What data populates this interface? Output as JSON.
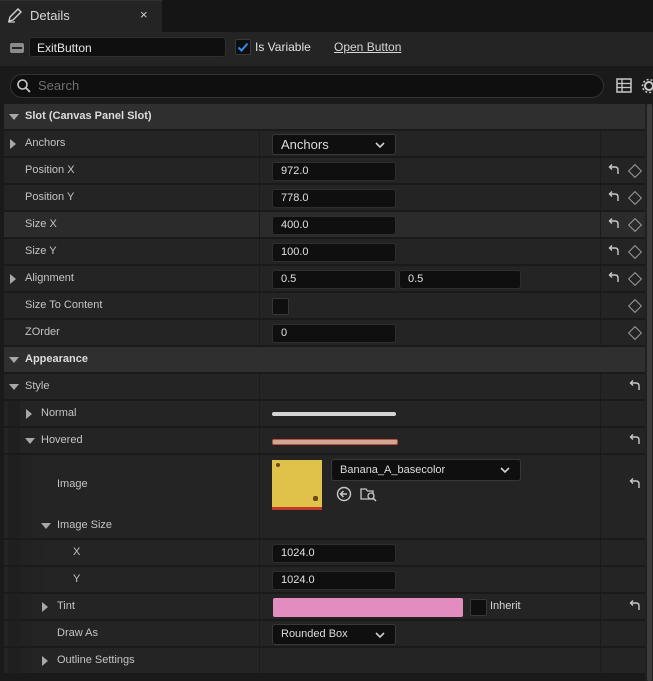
{
  "tab": {
    "title": "Details",
    "close": "×",
    "icon": "pencil-icon"
  },
  "header": {
    "name_value": "ExitButton",
    "is_variable_label": "Is Variable",
    "is_variable_checked": true,
    "open_button_label": "Open Button"
  },
  "search": {
    "placeholder": "Search"
  },
  "slot": {
    "category": "Slot (Canvas Panel Slot)",
    "anchors_label": "Anchors",
    "anchors_value": "Anchors",
    "position_x_label": "Position X",
    "position_x": "972.0",
    "position_y_label": "Position Y",
    "position_y": "778.0",
    "size_x_label": "Size X",
    "size_x": "400.0",
    "size_y_label": "Size Y",
    "size_y": "100.0",
    "alignment_label": "Alignment",
    "alignment_x": "0.5",
    "alignment_y": "0.5",
    "size_to_content_label": "Size To Content",
    "size_to_content_checked": false,
    "zorder_label": "ZOrder",
    "zorder": "0"
  },
  "appearance": {
    "category": "Appearance",
    "style_label": "Style",
    "normal_label": "Normal",
    "hovered_label": "Hovered",
    "image_label": "Image",
    "image_asset": "Banana_A_basecolor",
    "image_size_label": "Image Size",
    "x_label": "X",
    "image_size_x": "1024.0",
    "y_label": "Y",
    "image_size_y": "1024.0",
    "tint_label": "Tint",
    "tint_color": "#e38cc0",
    "inherit_label": "Inherit",
    "draw_as_label": "Draw As",
    "draw_as_value": "Rounded Box",
    "outline_label": "Outline Settings"
  },
  "colors": {
    "accent_check": "#2e8cf0",
    "normal_swatch": "#d4d4d4",
    "hovered_swatch": "#d4a596",
    "thumb_color": "#e0c14a"
  }
}
